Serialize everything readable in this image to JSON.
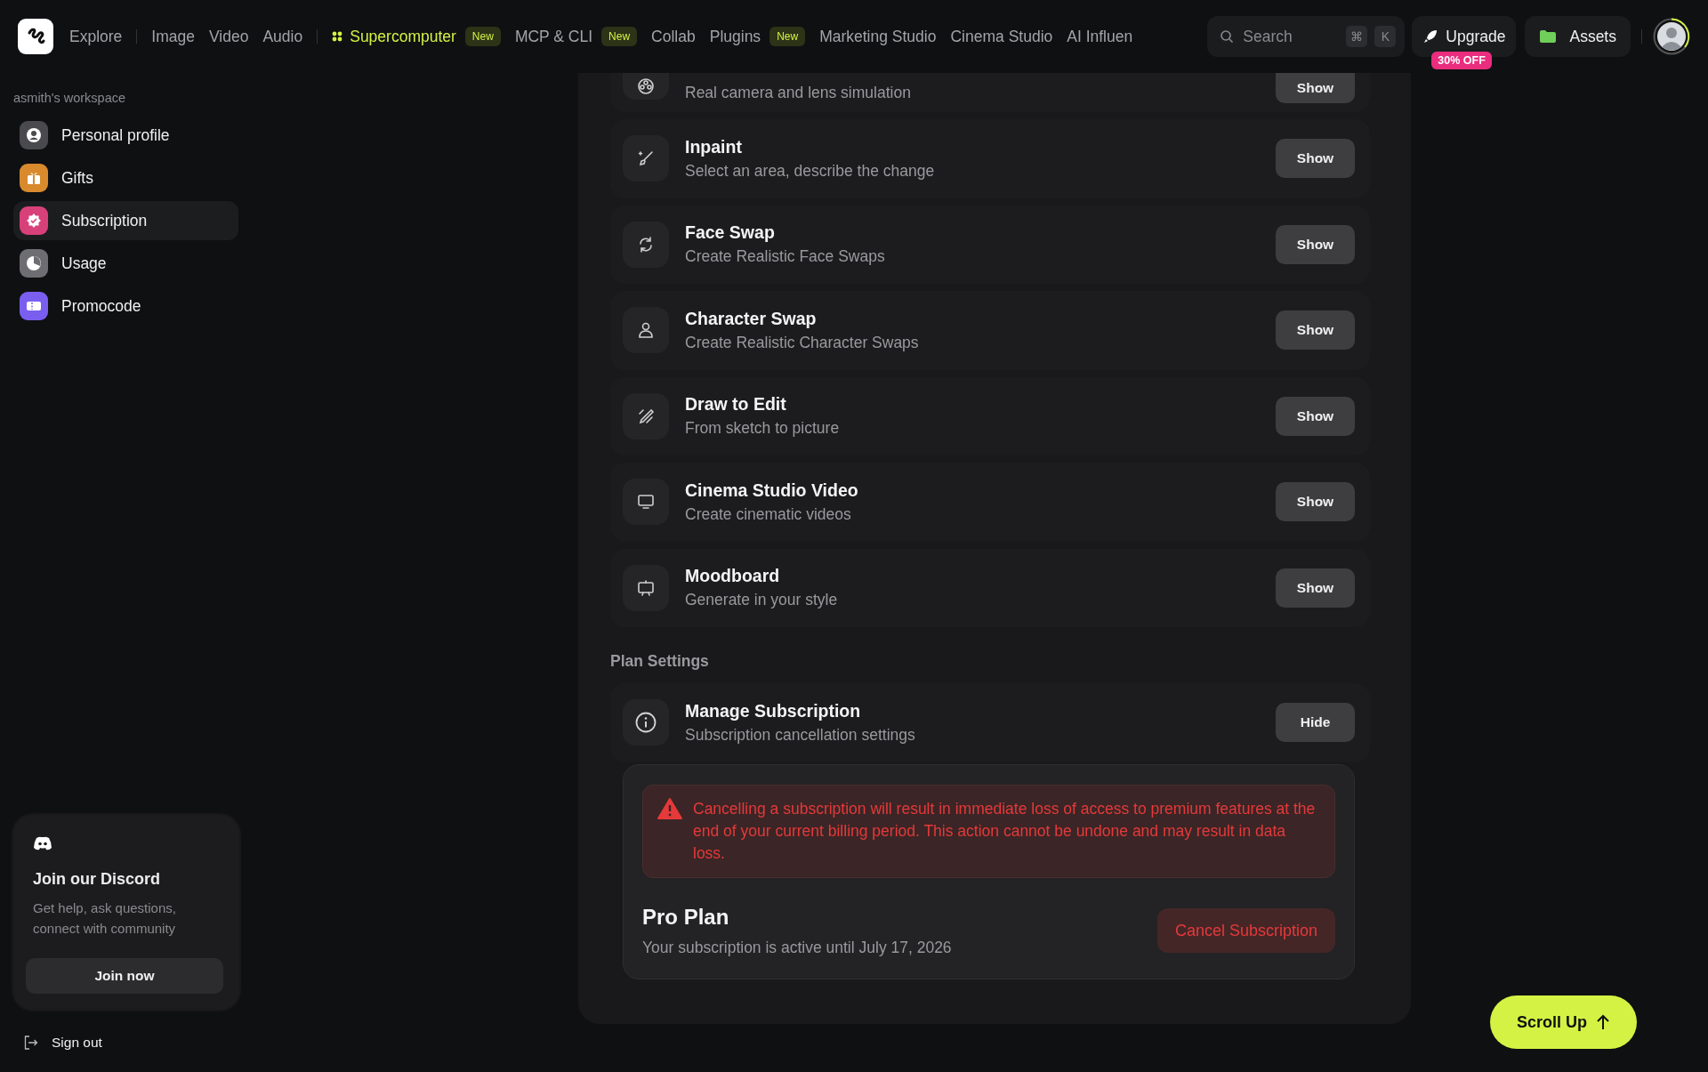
{
  "nav": {
    "groups": [
      [
        {
          "label": "Explore",
          "featured": false
        }
      ],
      [
        {
          "label": "Image",
          "featured": false
        },
        {
          "label": "Video",
          "featured": false
        },
        {
          "label": "Audio",
          "featured": false
        }
      ],
      [
        {
          "label": "Supercomputer",
          "featured": true,
          "badge": "New"
        },
        {
          "label": "MCP & CLI",
          "featured": false,
          "badge": "New"
        },
        {
          "label": "Collab",
          "featured": false
        },
        {
          "label": "Plugins",
          "featured": false,
          "badge": "New"
        },
        {
          "label": "Marketing Studio",
          "featured": false
        },
        {
          "label": "Cinema Studio",
          "featured": false
        },
        {
          "label": "AI Influen",
          "featured": false
        }
      ]
    ],
    "search": {
      "placeholder": "Search",
      "keys": [
        "⌘",
        "K"
      ]
    },
    "upgrade": {
      "label": "Upgrade",
      "badge": "30% OFF"
    },
    "assets": {
      "label": "Assets"
    }
  },
  "sidebar": {
    "workspace": "asmith's workspace",
    "items": [
      {
        "label": "Personal profile",
        "color": "#4a4a4e",
        "selected": false
      },
      {
        "label": "Gifts",
        "color": "#d88a2c",
        "selected": false
      },
      {
        "label": "Subscription",
        "color": "#d8407a",
        "selected": true
      },
      {
        "label": "Usage",
        "color": "#6e6e72",
        "selected": false
      },
      {
        "label": "Promocode",
        "color": "#7a5ef0",
        "selected": false
      }
    ],
    "discord": {
      "title": "Join our Discord",
      "text": "Get help, ask questions, connect with community",
      "button": "Join now"
    },
    "sign_out": "Sign out"
  },
  "features": [
    {
      "subtitle": "Real camera and lens simulation",
      "action": "Show"
    },
    {
      "title": "Inpaint",
      "subtitle": "Select an area, describe the change",
      "action": "Show"
    },
    {
      "title": "Face Swap",
      "subtitle": "Create Realistic Face Swaps",
      "action": "Show"
    },
    {
      "title": "Character Swap",
      "subtitle": "Create Realistic Character Swaps",
      "action": "Show"
    },
    {
      "title": "Draw to Edit",
      "subtitle": "From sketch to picture",
      "action": "Show"
    },
    {
      "title": "Cinema Studio Video",
      "subtitle": "Create cinematic videos",
      "action": "Show"
    },
    {
      "title": "Moodboard",
      "subtitle": "Generate in your style",
      "action": "Show"
    }
  ],
  "plan_settings": {
    "heading": "Plan Settings",
    "manage": {
      "title": "Manage Subscription",
      "subtitle": "Subscription cancellation settings",
      "action": "Hide",
      "expanded": true
    },
    "warning": "Cancelling a subscription will result in immediate loss of access to premium features at the end of your current billing period. This action cannot be undone and may result in data loss.",
    "plan": "Pro Plan",
    "status": "Your subscription is active until July 17, 2026",
    "cancel_button": "Cancel Subscription"
  },
  "scroll_up": "Scroll Up"
}
